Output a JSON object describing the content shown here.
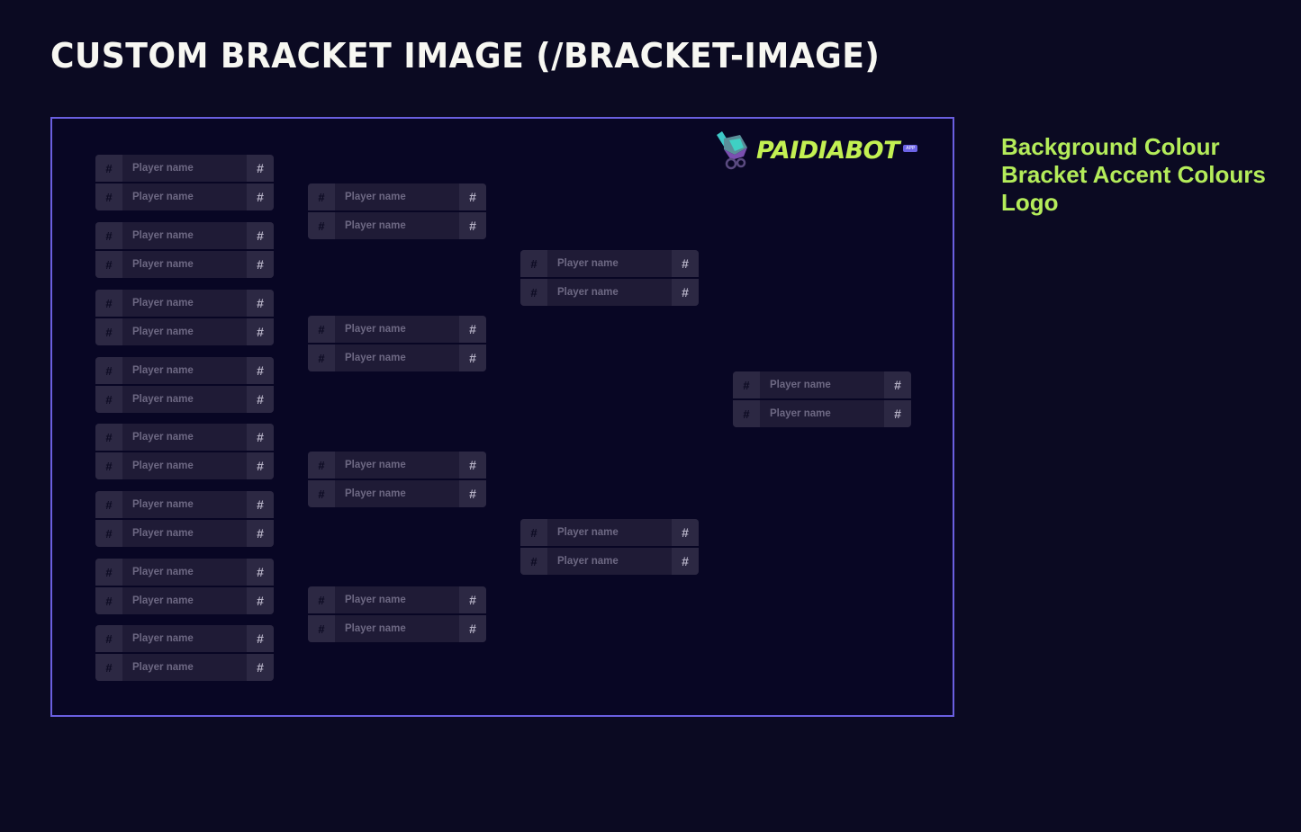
{
  "title": "CUSTOM BRACKET IMAGE (/BRACKET-IMAGE)",
  "notes": [
    "Background Colour",
    "Bracket Accent Colours",
    "Logo"
  ],
  "logo": {
    "text": "PAIDIABOT",
    "badge": "APP",
    "icon": "paidiabot-mascot-icon"
  },
  "colors": {
    "background": "#0b0a22",
    "frame_border": "#6a5fe0",
    "accent_text": "#b4ec5a",
    "logo_green": "#c3f052",
    "cell_dark": "#1f1b36",
    "cell_light": "#2c2843"
  },
  "bracket": {
    "seed_placeholder": "#",
    "score_placeholder": "#",
    "player_placeholder": "Player name",
    "rounds": [
      {
        "name": "round-1",
        "matches": 8
      },
      {
        "name": "round-2",
        "matches": 4
      },
      {
        "name": "round-3",
        "matches": 2
      },
      {
        "name": "final",
        "matches": 1
      }
    ]
  }
}
